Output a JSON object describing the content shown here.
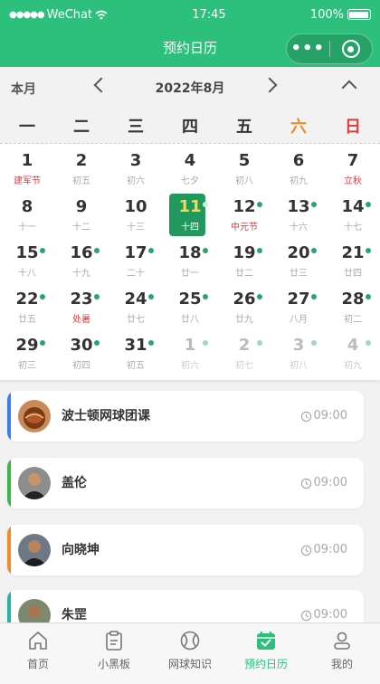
{
  "status_bar": {
    "signal": "●●●●●",
    "carrier": "WeChat",
    "time": "17:45",
    "battery": "100%"
  },
  "nav": {
    "title": "预约日历",
    "more_glyph": "•••"
  },
  "calendar": {
    "this_month_label": "本月",
    "month_label": "2022年8月",
    "weekdays": [
      "一",
      "二",
      "三",
      "四",
      "五",
      "六",
      "日"
    ],
    "days": [
      {
        "day": "1",
        "lunar": "建军节",
        "red": true,
        "dot": false,
        "other": false
      },
      {
        "day": "2",
        "lunar": "初五",
        "red": false,
        "dot": false,
        "other": false
      },
      {
        "day": "3",
        "lunar": "初六",
        "red": false,
        "dot": false,
        "other": false
      },
      {
        "day": "4",
        "lunar": "七夕",
        "red": false,
        "dot": false,
        "other": false
      },
      {
        "day": "5",
        "lunar": "初八",
        "red": false,
        "dot": false,
        "other": false
      },
      {
        "day": "6",
        "lunar": "初九",
        "red": false,
        "dot": false,
        "other": false
      },
      {
        "day": "7",
        "lunar": "立秋",
        "red": true,
        "dot": false,
        "other": false
      },
      {
        "day": "8",
        "lunar": "十一",
        "red": false,
        "dot": false,
        "other": false
      },
      {
        "day": "9",
        "lunar": "十二",
        "red": false,
        "dot": false,
        "other": false
      },
      {
        "day": "10",
        "lunar": "十三",
        "red": false,
        "dot": false,
        "other": false
      },
      {
        "day": "11",
        "lunar": "十四",
        "red": false,
        "dot": true,
        "other": false,
        "today": true
      },
      {
        "day": "12",
        "lunar": "中元节",
        "red": true,
        "dot": true,
        "other": false
      },
      {
        "day": "13",
        "lunar": "十六",
        "red": false,
        "dot": true,
        "other": false
      },
      {
        "day": "14",
        "lunar": "十七",
        "red": false,
        "dot": true,
        "other": false
      },
      {
        "day": "15",
        "lunar": "十八",
        "red": false,
        "dot": true,
        "other": false
      },
      {
        "day": "16",
        "lunar": "十九",
        "red": false,
        "dot": true,
        "other": false
      },
      {
        "day": "17",
        "lunar": "二十",
        "red": false,
        "dot": true,
        "other": false
      },
      {
        "day": "18",
        "lunar": "廿一",
        "red": false,
        "dot": true,
        "other": false
      },
      {
        "day": "19",
        "lunar": "廿二",
        "red": false,
        "dot": true,
        "other": false
      },
      {
        "day": "20",
        "lunar": "廿三",
        "red": false,
        "dot": true,
        "other": false
      },
      {
        "day": "21",
        "lunar": "廿四",
        "red": false,
        "dot": true,
        "other": false
      },
      {
        "day": "22",
        "lunar": "廿五",
        "red": false,
        "dot": true,
        "other": false
      },
      {
        "day": "23",
        "lunar": "处暑",
        "red": true,
        "dot": true,
        "other": false
      },
      {
        "day": "24",
        "lunar": "廿七",
        "red": false,
        "dot": true,
        "other": false
      },
      {
        "day": "25",
        "lunar": "廿八",
        "red": false,
        "dot": true,
        "other": false
      },
      {
        "day": "26",
        "lunar": "廿九",
        "red": false,
        "dot": true,
        "other": false
      },
      {
        "day": "27",
        "lunar": "八月",
        "red": false,
        "dot": true,
        "other": false
      },
      {
        "day": "28",
        "lunar": "初二",
        "red": false,
        "dot": true,
        "other": false
      },
      {
        "day": "29",
        "lunar": "初三",
        "red": false,
        "dot": true,
        "other": false
      },
      {
        "day": "30",
        "lunar": "初四",
        "red": false,
        "dot": true,
        "other": false
      },
      {
        "day": "31",
        "lunar": "初五",
        "red": false,
        "dot": true,
        "other": false
      },
      {
        "day": "1",
        "lunar": "初六",
        "red": false,
        "dot": true,
        "other": true
      },
      {
        "day": "2",
        "lunar": "初七",
        "red": false,
        "dot": true,
        "other": true
      },
      {
        "day": "3",
        "lunar": "初八",
        "red": false,
        "dot": true,
        "other": true
      },
      {
        "day": "4",
        "lunar": "初九",
        "red": false,
        "dot": true,
        "other": true
      }
    ]
  },
  "appointments": [
    {
      "name": "波士顿网球团课",
      "time": "09:00",
      "bar_color": "#3b7df0",
      "avatar": "tennis-ball-avatar"
    },
    {
      "name": "盖伦",
      "time": "09:00",
      "bar_color": "#3cb84a",
      "avatar": "person-avatar"
    },
    {
      "name": "向晓坤",
      "time": "09:00",
      "bar_color": "#f08c2a",
      "avatar": "person-avatar"
    },
    {
      "name": "朱罡",
      "time": "09:00",
      "bar_color": "#26b3a6",
      "avatar": "person-avatar"
    }
  ],
  "tabs": [
    {
      "label": "首页",
      "icon": "home-icon",
      "active": false
    },
    {
      "label": "小黑板",
      "icon": "clipboard-icon",
      "active": false
    },
    {
      "label": "网球知识",
      "icon": "tennis-ball-icon",
      "active": false
    },
    {
      "label": "预约日历",
      "icon": "calendar-check-icon",
      "active": true
    },
    {
      "label": "我的",
      "icon": "user-icon",
      "active": false
    }
  ],
  "colors": {
    "brand": "#2dbf7c",
    "today_bg": "#21985e",
    "dot": "#2aa66a"
  }
}
